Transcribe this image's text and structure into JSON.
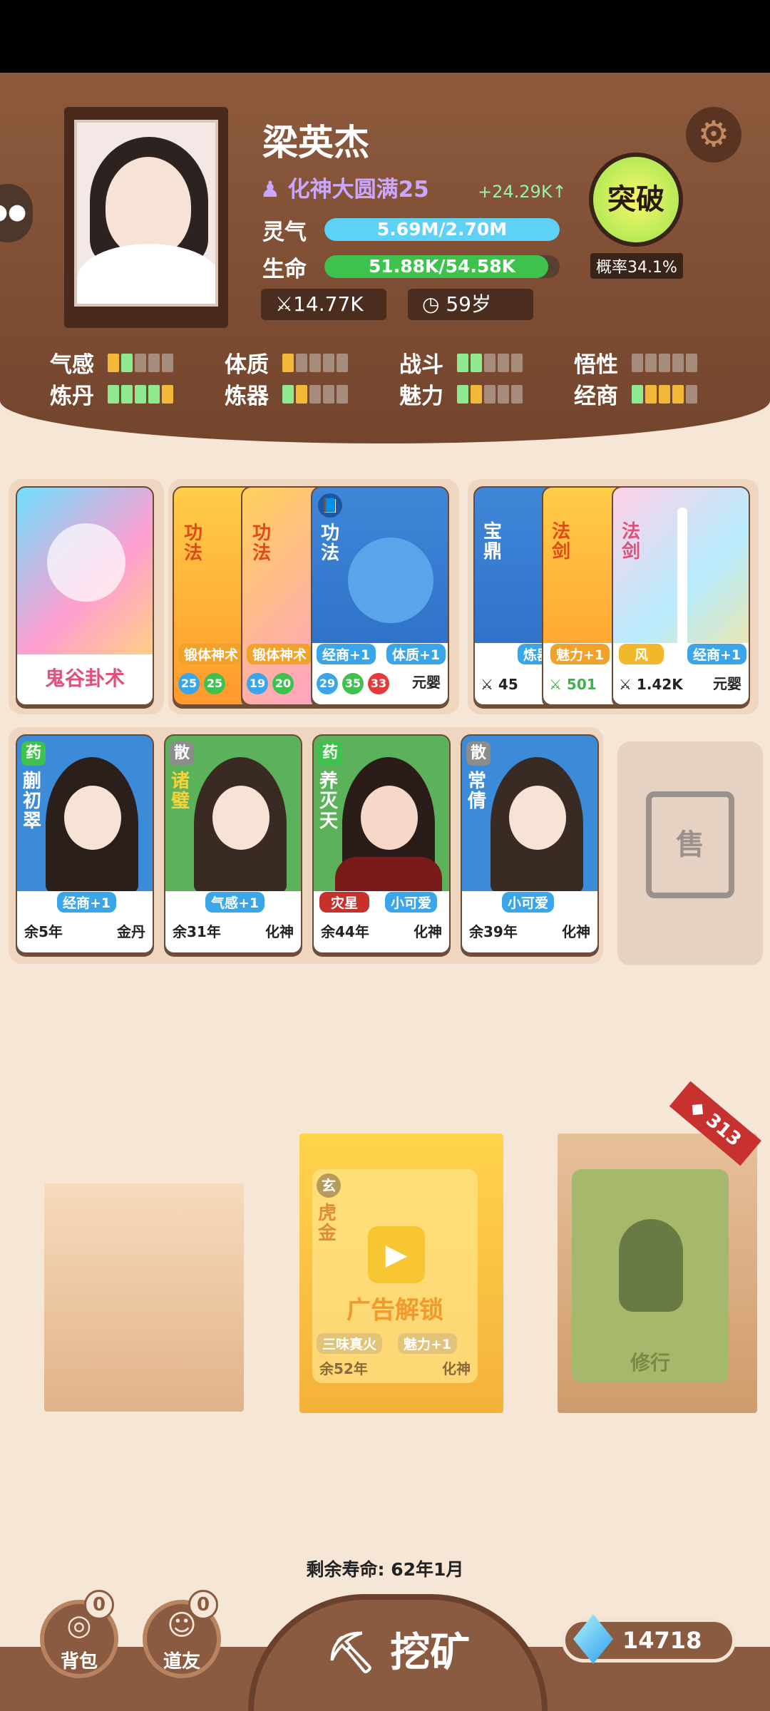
{
  "player": {
    "name": "梁英杰",
    "realm": "化神大圆满25",
    "gain": "+24.29K↑",
    "qi_label": "灵气",
    "qi_value": "5.69M/2.70M",
    "qi_fill": 1.0,
    "life_label": "生命",
    "life_value": "51.88K/54.58K",
    "life_fill": 0.95,
    "power": "14.77K",
    "age": "59岁",
    "breakthrough_label": "突破",
    "probability": "概率34.1%"
  },
  "attributes": [
    {
      "label": "气感"
    },
    {
      "label": "体质"
    },
    {
      "label": "战斗"
    },
    {
      "label": "悟性"
    },
    {
      "label": "炼丹"
    },
    {
      "label": "炼器"
    },
    {
      "label": "魅力"
    },
    {
      "label": "经商"
    }
  ],
  "skill_cards": {
    "single": {
      "name": "鬼谷卦术"
    },
    "stack": {
      "type": "功法",
      "tags": [
        "锻体神术",
        "锻体神术",
        "经商+1",
        "体质+1"
      ],
      "nums": [
        "25",
        "25",
        "19",
        "20",
        "29",
        "35",
        "33"
      ],
      "realm": "元婴"
    },
    "treasures": {
      "labels": [
        "宝鼎",
        "法剑",
        "法剑"
      ],
      "tags": [
        "炼器",
        "魅力+1",
        "风",
        "经商+1"
      ],
      "powers": [
        "45",
        "501",
        "1.42K"
      ],
      "realm": "元婴"
    }
  },
  "companions": [
    {
      "badge": "药",
      "name": "蒯初翠",
      "tag": "经商+1",
      "life": "余5年",
      "realm": "金丹"
    },
    {
      "badge": "散",
      "name": "诸璧",
      "tag": "气感+1",
      "life": "余31年",
      "realm": "化神"
    },
    {
      "badge": "药",
      "name": "养灭天",
      "tag1": "灾星",
      "tag2": "小可爱",
      "life": "余44年",
      "realm": "化神"
    },
    {
      "badge": "散",
      "name": "常倩",
      "tag": "小可爱",
      "life": "余39年",
      "realm": "化神"
    }
  ],
  "sell_slot": {
    "glyph": "售"
  },
  "packs": {
    "ad_unlock": "广告解锁",
    "ad_card": {
      "badge": "玄",
      "name": "虎金",
      "tag1": "三味真火",
      "tag2": "魅力+1",
      "life": "余52年",
      "realm": "化神"
    },
    "practice_label": "修行",
    "practice_count": "313"
  },
  "remaining_life": "剩余寿命: 62年1月",
  "bottom": {
    "bag_label": "背包",
    "bag_count": "0",
    "friend_label": "道友",
    "friend_count": "0",
    "mine_label": "挖矿",
    "gems": "14718"
  }
}
